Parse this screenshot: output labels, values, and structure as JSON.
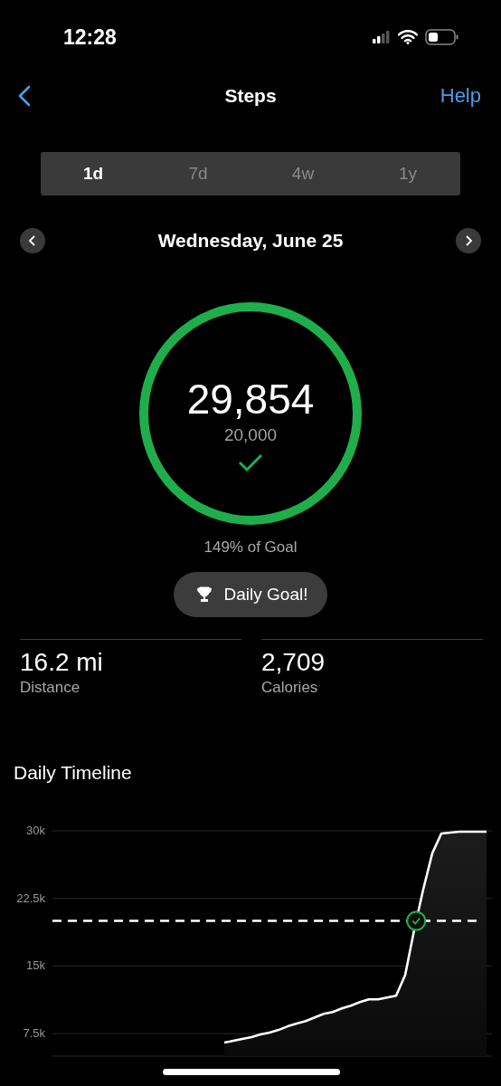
{
  "status_bar": {
    "time": "12:28"
  },
  "nav": {
    "title": "Steps",
    "help": "Help"
  },
  "tabs": [
    {
      "label": "1d",
      "selected": true
    },
    {
      "label": "7d",
      "selected": false
    },
    {
      "label": "4w",
      "selected": false
    },
    {
      "label": "1y",
      "selected": false
    }
  ],
  "date_nav": {
    "date": "Wednesday, June 25"
  },
  "ring": {
    "steps": "29,854",
    "goal": "20,000",
    "level": 1,
    "goal_met": true
  },
  "percent": "149% of Goal",
  "badge": {
    "label": "Daily Goal!"
  },
  "stats": [
    {
      "value": "16.2 mi",
      "label": "Distance"
    },
    {
      "value": "2,709",
      "label": "Calories"
    }
  ],
  "timeline": {
    "title": "Daily Timeline",
    "chart_data": {
      "type": "area",
      "grid": true,
      "ylim": [
        5000,
        30000
      ],
      "yticks": [
        {
          "value": 7500,
          "label": "7.5k"
        },
        {
          "value": 15000,
          "label": "15k"
        },
        {
          "value": 22500,
          "label": "22.5k"
        },
        {
          "value": 30000,
          "label": "30k"
        }
      ],
      "series": [
        {
          "color": "#ffffff",
          "values": [
            null,
            null,
            null,
            null,
            null,
            null,
            null,
            null,
            null,
            null,
            null,
            null,
            null,
            null,
            null,
            null,
            null,
            null,
            null,
            6500,
            6700,
            6900,
            7100,
            7400,
            7600,
            7900,
            8300,
            8600,
            8900,
            9300,
            9700,
            9900,
            10300,
            10600,
            11000,
            11300,
            11300,
            11500,
            11700,
            14000,
            19000,
            23500,
            27500,
            29700,
            29800,
            29900,
            29900,
            29900,
            29900
          ]
        }
      ],
      "ref_lines": [
        {
          "axis": "y",
          "value": 20000
        }
      ]
    }
  }
}
